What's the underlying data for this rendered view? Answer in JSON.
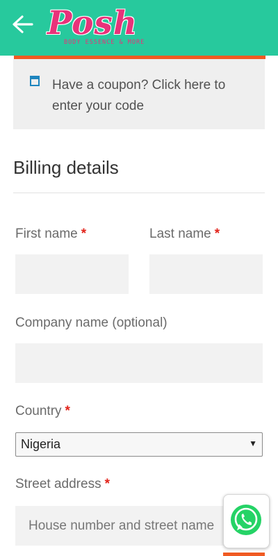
{
  "header": {
    "brand": "Posh",
    "tagline": "BODY ESSENCE & MORE",
    "brand_color": "#27c99d",
    "accent_color": "#f05a22"
  },
  "coupon": {
    "icon": "coupon-window-icon",
    "text": "Have a coupon? Click here to enter your code"
  },
  "billing": {
    "title": "Billing details",
    "first_name_label": "First name",
    "last_name_label": "Last name",
    "company_label": "Company name (optional)",
    "country_label": "Country",
    "country_value": "Nigeria",
    "street_label": "Street address",
    "street_placeholder": "House number and street name",
    "required_mark": "*"
  },
  "whatsapp": {
    "icon": "whatsapp-icon",
    "color": "#25d366"
  }
}
